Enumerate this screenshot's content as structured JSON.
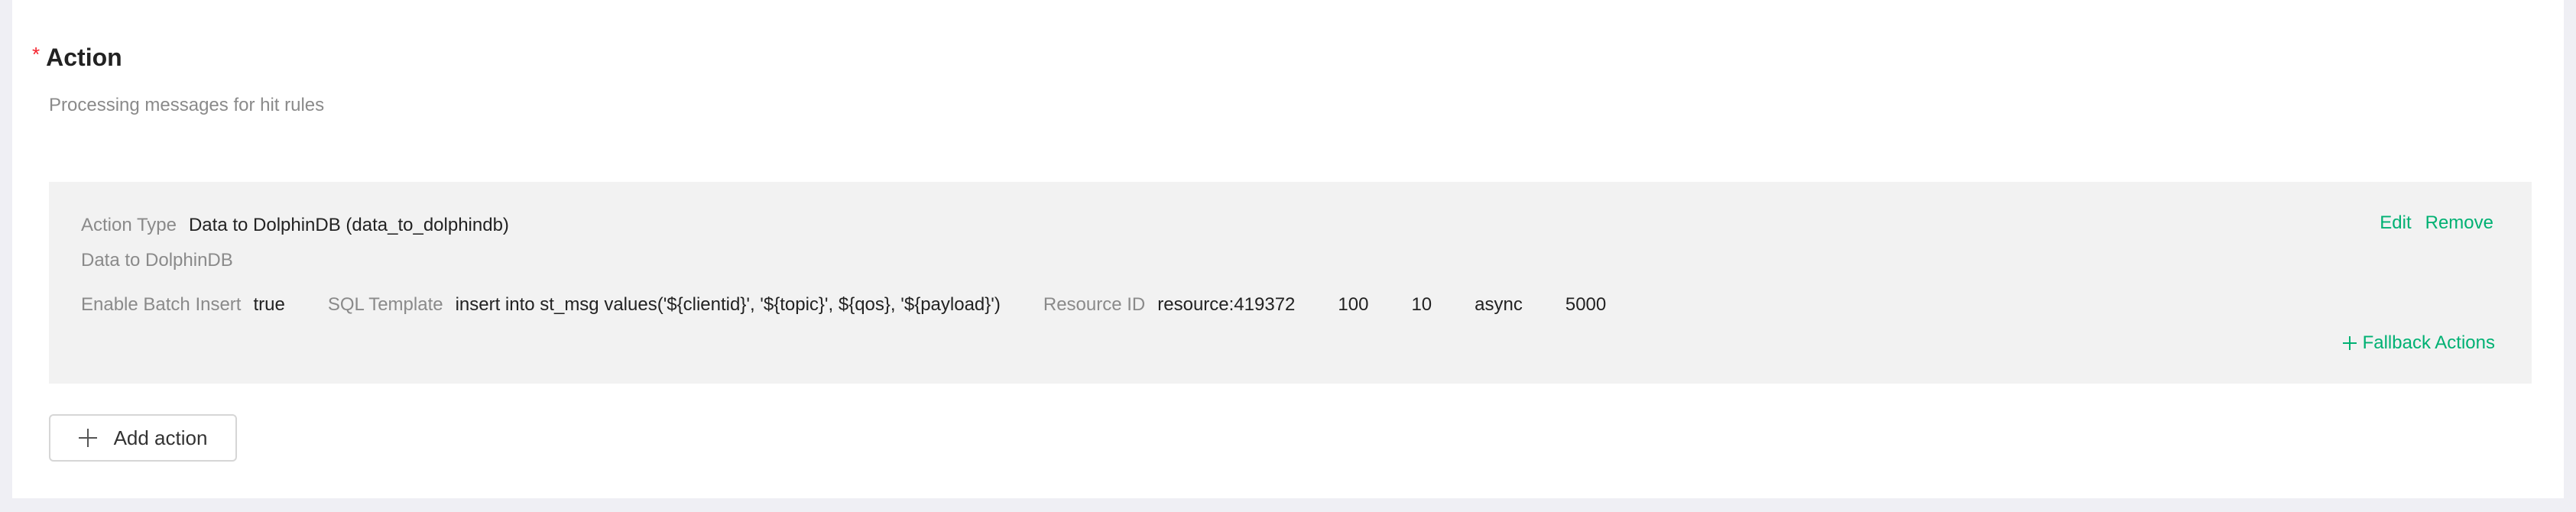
{
  "section": {
    "required_mark": "*",
    "title": "Action",
    "description": "Processing messages for hit rules"
  },
  "action": {
    "type_label": "Action Type",
    "type_value": "Data to DolphinDB (data_to_dolphindb)",
    "description": "Data to DolphinDB",
    "edit_label": "Edit",
    "remove_label": "Remove",
    "params": {
      "batch_insert_label": "Enable Batch Insert",
      "batch_insert_value": "true",
      "sql_template_label": "SQL Template",
      "sql_template_value": "insert into st_msg values('${clientid}', '${topic}', ${qos}, '${payload}')",
      "resource_id_label": "Resource ID",
      "resource_id_value": "resource:419372",
      "value_1": "100",
      "value_2": "10",
      "value_3": "async",
      "value_4": "5000"
    },
    "fallback_label": "Fallback Actions"
  },
  "add_action_label": "Add action",
  "colors": {
    "accent": "#00b173",
    "required": "#f5222d",
    "card_bg": "#f2f2f2",
    "page_bg": "#efeff4"
  },
  "icons": {
    "fallback": "plus-icon",
    "add_action": "plus-icon"
  }
}
